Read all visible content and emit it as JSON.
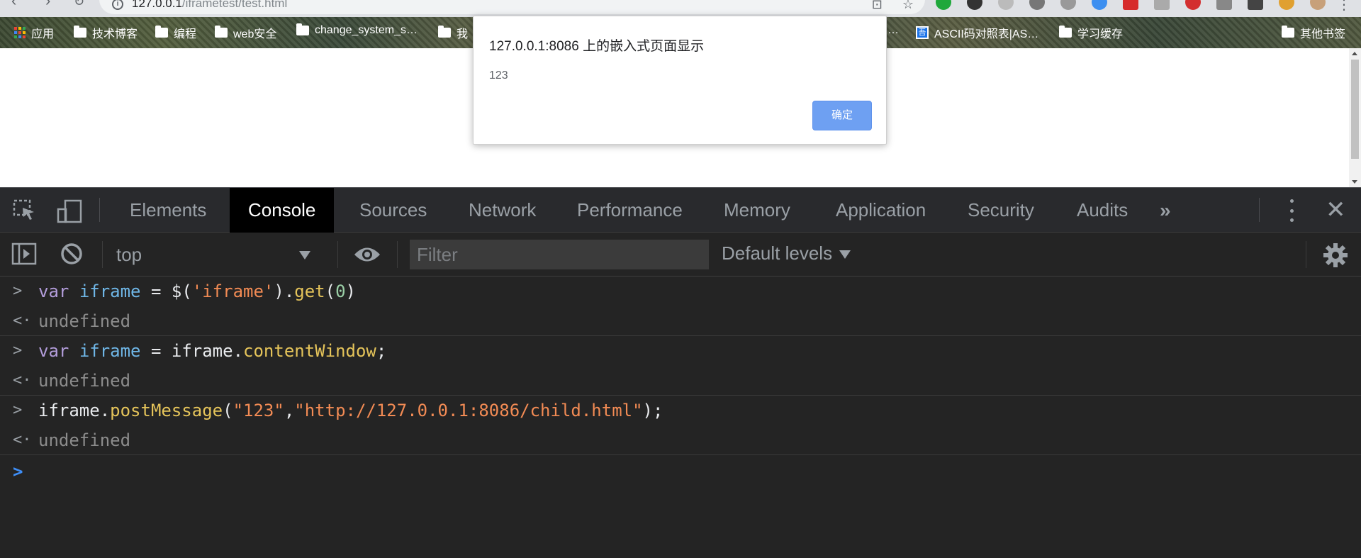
{
  "browser": {
    "url_host": "127.0.0.1",
    "url_path": "/iframetest/test.html",
    "bookmarks": [
      {
        "label": "应用",
        "type": "apps"
      },
      {
        "label": "技术博客",
        "type": "folder"
      },
      {
        "label": "编程",
        "type": "folder"
      },
      {
        "label": "web安全",
        "type": "folder"
      },
      {
        "label": "change_system_s…",
        "type": "folder"
      },
      {
        "label": "我",
        "type": "folder"
      },
      {
        "label": "…",
        "type": "text"
      },
      {
        "label": "ASCII码对照表|AS…",
        "type": "site"
      },
      {
        "label": "学习缓存",
        "type": "folder"
      },
      {
        "label": "其他书签",
        "type": "folder"
      }
    ]
  },
  "dialog": {
    "title": "127.0.0.1:8086 上的嵌入式页面显示",
    "message": "123",
    "ok_label": "确定"
  },
  "devtools": {
    "tabs": [
      "Elements",
      "Console",
      "Sources",
      "Network",
      "Performance",
      "Memory",
      "Application",
      "Security",
      "Audits"
    ],
    "active_tab": "Console",
    "overflow_label": "»",
    "close_label": "✕",
    "toolbar": {
      "context": "top",
      "filter_placeholder": "Filter",
      "levels_label": "Default levels"
    },
    "console": {
      "entries": [
        {
          "input_tokens": [
            {
              "t": "var",
              "c": "kw"
            },
            {
              "t": " ",
              "c": "op"
            },
            {
              "t": "iframe",
              "c": "vn"
            },
            {
              "t": " = ",
              "c": "op"
            },
            {
              "t": "$(",
              "c": "op"
            },
            {
              "t": "'iframe'",
              "c": "str"
            },
            {
              "t": ").",
              "c": "op"
            },
            {
              "t": "get",
              "c": "fn"
            },
            {
              "t": "(",
              "c": "op"
            },
            {
              "t": "0",
              "c": "num"
            },
            {
              "t": ")",
              "c": "op"
            }
          ],
          "result": "undefined"
        },
        {
          "input_tokens": [
            {
              "t": "var",
              "c": "kw"
            },
            {
              "t": " ",
              "c": "op"
            },
            {
              "t": "iframe",
              "c": "vn"
            },
            {
              "t": " = ",
              "c": "op"
            },
            {
              "t": "iframe.",
              "c": "op"
            },
            {
              "t": "contentWindow",
              "c": "fn"
            },
            {
              "t": ";",
              "c": "op"
            }
          ],
          "result": "undefined"
        },
        {
          "input_tokens": [
            {
              "t": "iframe.",
              "c": "op"
            },
            {
              "t": "postMessage",
              "c": "fn"
            },
            {
              "t": "(",
              "c": "op"
            },
            {
              "t": "\"123\"",
              "c": "str"
            },
            {
              "t": ",",
              "c": "op"
            },
            {
              "t": "\"http://127.0.0.1:8086/child.html\"",
              "c": "str"
            },
            {
              "t": ");",
              "c": "op"
            }
          ],
          "result": "undefined"
        }
      ],
      "input_marker": ">",
      "result_marker": "<·",
      "prompt_marker": ">"
    }
  },
  "colors": {
    "devtools_bg": "#242424",
    "active_tab_bg": "#000000",
    "dialog_button": "#6ea0f2",
    "prompt_caret": "#3e8ef7"
  }
}
